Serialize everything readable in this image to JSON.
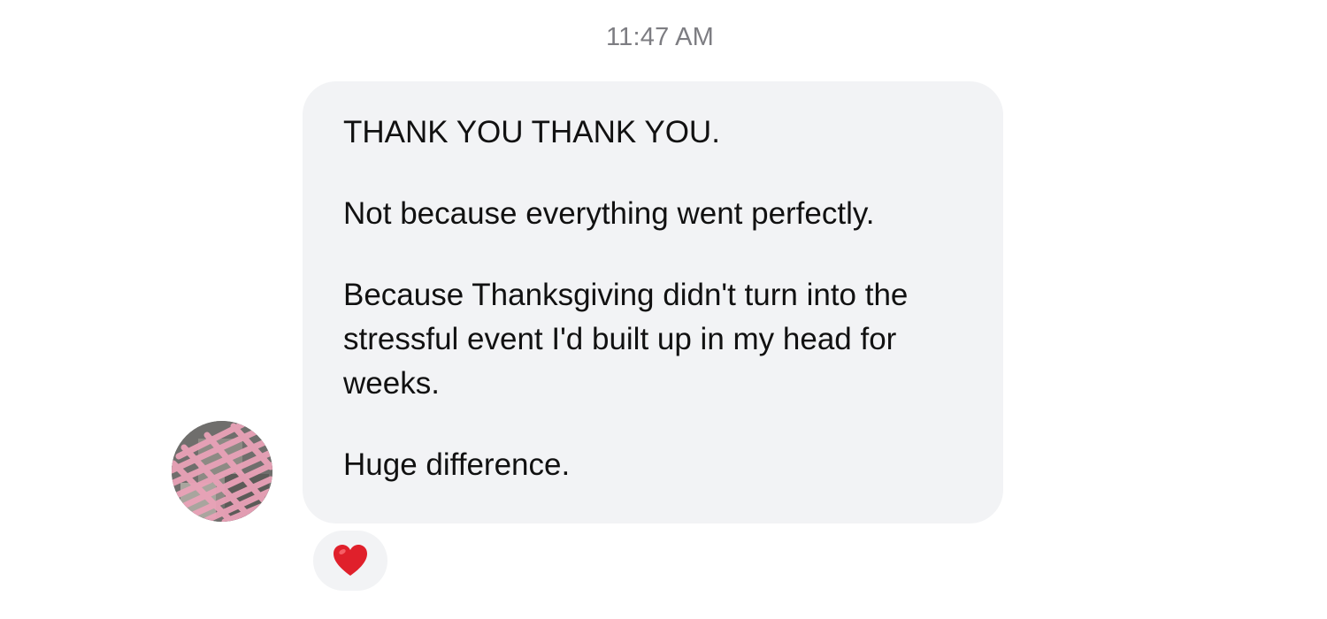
{
  "conversation": {
    "timestamp": "11:47 AM",
    "message": {
      "lines": [
        "THANK YOU THANK YOU.",
        "Not because everything went perfectly.",
        "Because Thanksgiving didn't turn into the",
        "stressful event I'd built up in my head for",
        "weeks.",
        "Huge difference."
      ]
    },
    "reaction": {
      "icon": "red-heart-icon",
      "color": "#e0202b"
    },
    "avatar": {
      "icon": "redacted-avatar",
      "scribble_color": "#e9a2b8"
    }
  }
}
